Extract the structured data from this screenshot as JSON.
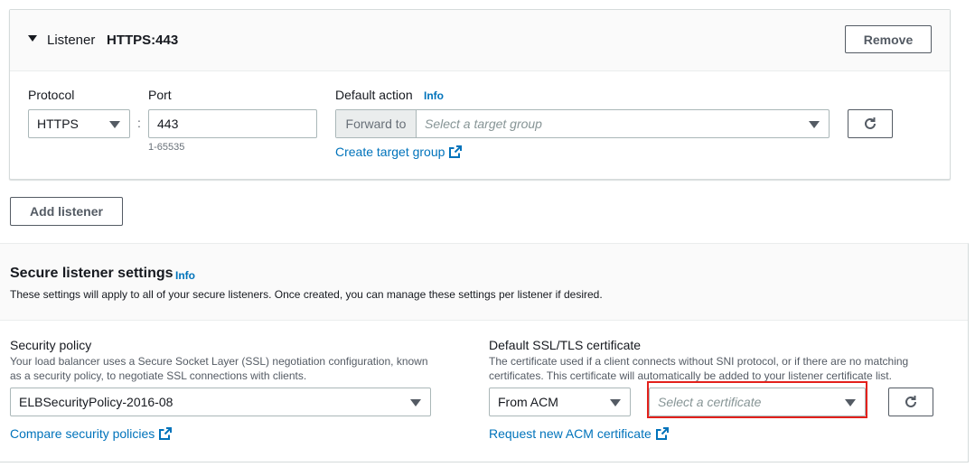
{
  "listener": {
    "label": "Listener",
    "name": "HTTPS:443",
    "remove_label": "Remove",
    "protocol": {
      "label": "Protocol",
      "value": "HTTPS"
    },
    "port": {
      "label": "Port",
      "value": "443",
      "hint": "1-65535",
      "separator": ":"
    },
    "default_action": {
      "label": "Default action",
      "info": "Info",
      "prefix": "Forward to",
      "placeholder": "Select a target group",
      "create_link": "Create target group"
    }
  },
  "add_listener_label": "Add listener",
  "secure": {
    "title": "Secure listener settings",
    "info": "Info",
    "description": "These settings will apply to all of your secure listeners. Once created, you can manage these settings per listener if desired.",
    "security_policy": {
      "label": "Security policy",
      "description_line1": "Your load balancer uses a Secure Socket Layer (SSL) negotiation configuration, known",
      "description_line2": "as a security policy, to negotiate SSL connections with clients.",
      "value": "ELBSecurityPolicy-2016-08",
      "compare_link": "Compare security policies"
    },
    "certificate": {
      "label": "Default SSL/TLS certificate",
      "description_line1": "The certificate used if a client connects without SNI protocol, or if there are no matching",
      "description_line2": "certificates. This certificate will automatically be added to your listener certificate list.",
      "source_value": "From ACM",
      "placeholder": "Select a certificate",
      "request_link": "Request new ACM certificate"
    }
  },
  "icons": {
    "collapse": "caret-down-icon",
    "dropdown": "triangle-down-icon",
    "refresh": "refresh-icon",
    "external": "external-link-icon"
  },
  "colors": {
    "link": "#0073bb",
    "highlight": "#e3211c",
    "border": "#aab7b8",
    "header_bg": "#fafafa"
  }
}
